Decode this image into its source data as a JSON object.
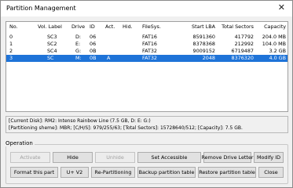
{
  "window": {
    "title": "Partition Management",
    "close_glyph": "✕"
  },
  "table": {
    "columns": [
      "No.",
      "Vol. Label",
      "Drive",
      "ID",
      "Act.",
      "Hid.",
      "FileSys.",
      "Start LBA",
      "Total Sectors",
      "Capacity"
    ],
    "rows": [
      {
        "no": "0",
        "label": "SC3",
        "drive": "D:",
        "id": "06",
        "act": "",
        "hid": "",
        "fs": "FAT16",
        "start": "8591360",
        "total": "417792",
        "cap": "204.0 MB"
      },
      {
        "no": "1",
        "label": "SC2",
        "drive": "E:",
        "id": "06",
        "act": "",
        "hid": "",
        "fs": "FAT16",
        "start": "8378368",
        "total": "212992",
        "cap": "104.0 MB"
      },
      {
        "no": "2",
        "label": "SC4",
        "drive": "G:",
        "id": "0B",
        "act": "",
        "hid": "",
        "fs": "FAT32",
        "start": "9009152",
        "total": "6719487",
        "cap": "3.2 GB"
      },
      {
        "no": "3",
        "label": "SC",
        "drive": "M:",
        "id": "0B",
        "act": "A",
        "hid": "",
        "fs": "FAT32",
        "start": "2048",
        "total": "8376320",
        "cap": "4.0 GB"
      }
    ],
    "selected_row": 3
  },
  "info": {
    "line1": "[Current Disk]:  RM2: Intenso Rainbow Line (7.5 GB, D: E: G:)",
    "line2": "[Partitioning sheme]:    MBR;     [C/H/S]: 979/255/63;   [Total Sectors]: 15728640/512;   [Capacity]: 7.5 GB."
  },
  "operation": {
    "label": "Operation",
    "buttons_row1": [
      "Activate",
      "Hide",
      "Unhide",
      "Set Accessible",
      "Remove Drive Letter",
      "Modify ID"
    ],
    "buttons_row2": [
      "Format this part",
      "U+ V2",
      "Re-Partitioning",
      "Backup partition table",
      "Restore partition table",
      "Close"
    ]
  }
}
